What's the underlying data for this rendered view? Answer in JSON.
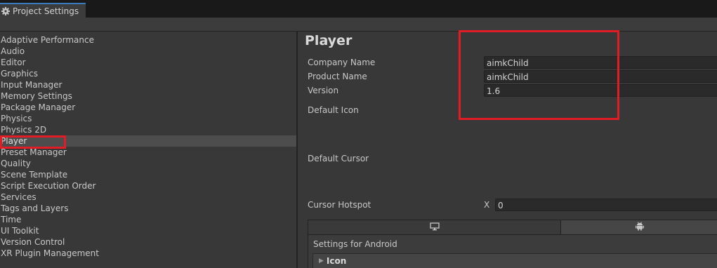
{
  "window": {
    "tab_title": "Project Settings"
  },
  "sidebar": {
    "items": [
      "Adaptive Performance",
      "Audio",
      "Editor",
      "Graphics",
      "Input Manager",
      "Memory Settings",
      "Package Manager",
      "Physics",
      "Physics 2D",
      "Player",
      "Preset Manager",
      "Quality",
      "Scene Template",
      "Script Execution Order",
      "Services",
      "Tags and Layers",
      "Time",
      "UI Toolkit",
      "Version Control",
      "XR Plugin Management"
    ],
    "selected": "Player"
  },
  "player": {
    "title": "Player",
    "company_name_label": "Company Name",
    "company_name_value": "aimkChild",
    "product_name_label": "Product Name",
    "product_name_value": "aimkChild",
    "version_label": "Version",
    "version_value": "1.6",
    "default_icon_label": "Default Icon",
    "default_cursor_label": "Default Cursor",
    "cursor_hotspot_label": "Cursor Hotspot",
    "cursor_hotspot_x_label": "X",
    "cursor_hotspot_x_value": "0"
  },
  "platform_tabs": [
    {
      "icon": "monitor-icon",
      "selected": false
    },
    {
      "icon": "android-icon",
      "selected": true
    }
  ],
  "settings_for": {
    "title": "Settings for Android",
    "icon_section": "Icon"
  },
  "colors": {
    "accent": "#3a79bb",
    "highlight": "#e21c24",
    "panel": "#383838",
    "field": "#2a2a2a"
  }
}
